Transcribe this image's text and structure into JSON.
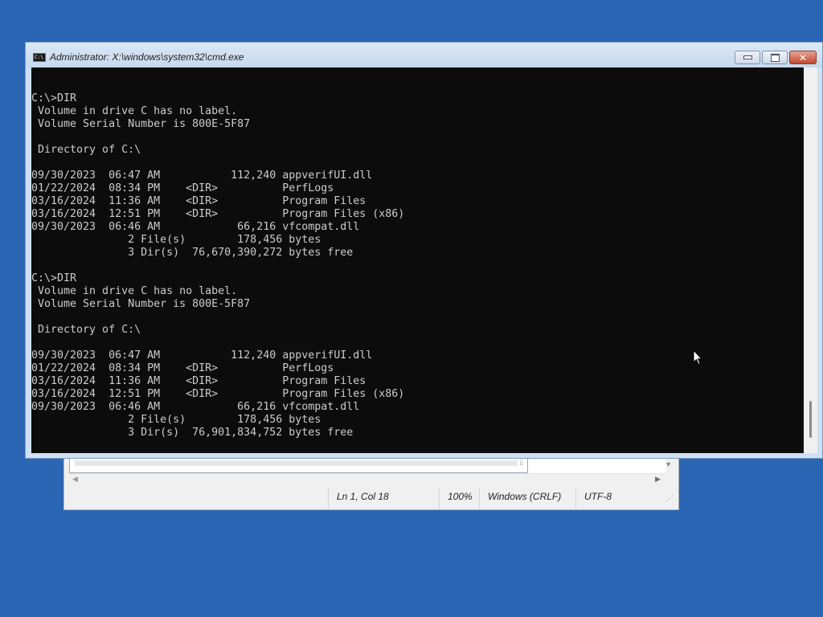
{
  "notepad": {
    "status": {
      "position": "Ln 1, Col 18",
      "zoom": "100%",
      "line_ending": "Windows (CRLF)",
      "encoding": "UTF-8"
    }
  },
  "cmd": {
    "title": "Administrator: X:\\windows\\system32\\cmd.exe",
    "lines": [
      "",
      "C:\\>DIR",
      " Volume in drive C has no label.",
      " Volume Serial Number is 800E-5F87",
      "",
      " Directory of C:\\",
      "",
      "09/30/2023  06:47 AM           112,240 appverifUI.dll",
      "01/22/2024  08:34 PM    <DIR>          PerfLogs",
      "03/16/2024  11:36 AM    <DIR>          Program Files",
      "03/16/2024  12:51 PM    <DIR>          Program Files (x86)",
      "09/30/2023  06:46 AM            66,216 vfcompat.dll",
      "               2 File(s)        178,456 bytes",
      "               3 Dir(s)  76,670,390,272 bytes free",
      "",
      "C:\\>DIR",
      " Volume in drive C has no label.",
      " Volume Serial Number is 800E-5F87",
      "",
      " Directory of C:\\",
      "",
      "09/30/2023  06:47 AM           112,240 appverifUI.dll",
      "01/22/2024  08:34 PM    <DIR>          PerfLogs",
      "03/16/2024  11:36 AM    <DIR>          Program Files",
      "03/16/2024  12:51 PM    <DIR>          Program Files (x86)",
      "09/30/2023  06:46 AM            66,216 vfcompat.dll",
      "               2 File(s)        178,456 bytes",
      "               3 Dir(s)  76,901,834,752 bytes free",
      ""
    ],
    "prompt": "C:\\>"
  },
  "colors": {
    "desktop": "#2a66b3",
    "console_bg": "#0c0c0c",
    "console_text": "#cccccc"
  },
  "icons": [
    "cmd-app-icon",
    "minimize-icon",
    "maximize-icon",
    "close-icon",
    "mouse-pointer-icon"
  ]
}
